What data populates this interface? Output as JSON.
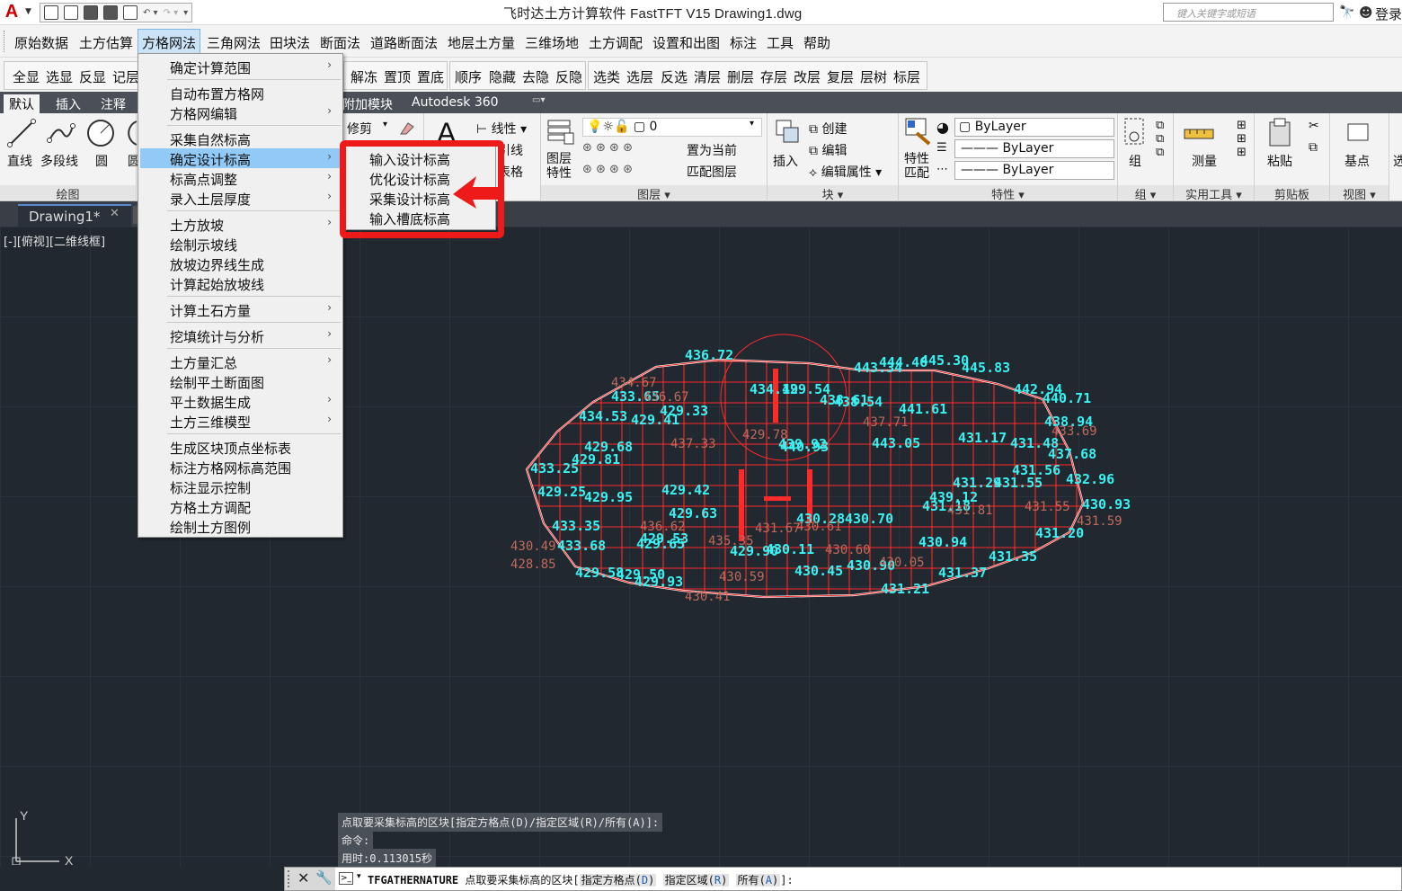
{
  "titlebar": {
    "title": "飞时达土方计算软件 FastTFT V15    Drawing1.dwg",
    "search_placeholder": "键入关键字或短语",
    "login_label": "登录"
  },
  "menubar": {
    "items": [
      "原始数据",
      "土方估算",
      "方格网法",
      "三角网法",
      "田块法",
      "断面法",
      "道路断面法",
      "地层土方量",
      "三维场地",
      "土方调配",
      "设置和出图",
      "标注",
      "工具",
      "帮助"
    ],
    "active_index": 2
  },
  "toolstrip": {
    "left_items": [
      "全显",
      "选显",
      "反显",
      "记层"
    ],
    "right_items": [
      "解冻",
      "置顶",
      "置底",
      "顺序",
      "隐藏",
      "去隐",
      "反隐",
      "选类",
      "选层",
      "反选",
      "清层",
      "删层",
      "存层",
      "改层",
      "复层",
      "层树",
      "标层"
    ]
  },
  "ribbon_tabs": {
    "items": [
      "默认",
      "插入",
      "注释",
      "附加模块",
      "Autodesk 360"
    ],
    "active_index": 0
  },
  "ribbon": {
    "draw": {
      "title": "绘图",
      "line": "直线",
      "polyline": "多段线",
      "circle": "圆",
      "arc": "圆"
    },
    "modify": {
      "trim": "修剪"
    },
    "annotation": {
      "linetype": "线性",
      "leader": "引线",
      "table": "表格"
    },
    "layers": {
      "title": "图层",
      "layer_props": "图层特性",
      "layer_value": "0",
      "set_current": "置为当前",
      "match_layer": "匹配图层"
    },
    "block": {
      "title": "块",
      "insert": "插入",
      "create": "创建",
      "edit": "编辑",
      "edit_attr": "编辑属性"
    },
    "properties": {
      "title": "特性",
      "match": "特性匹配",
      "color": "ByLayer",
      "linetype": "ByLayer",
      "lineweight": "ByLayer"
    },
    "groups": {
      "title": "组",
      "group": "组"
    },
    "utilities": {
      "title": "实用工具",
      "measure": "测量"
    },
    "clipboard": {
      "title": "剪贴板",
      "paste": "粘贴"
    },
    "view": {
      "title": "视图",
      "base": "基点",
      "select": "选"
    }
  },
  "doc_tab": {
    "label": "Drawing1*"
  },
  "viewport": {
    "label": "[-][俯视][二维线框]"
  },
  "dropdown": {
    "items": [
      {
        "label": "确定计算范围",
        "sub": true
      },
      {
        "label": "自动布置方格网",
        "sub": false
      },
      {
        "label": "方格网编辑",
        "sub": true
      },
      {
        "label": "采集自然标高",
        "sub": false
      },
      {
        "label": "确定设计标高",
        "sub": true
      },
      {
        "label": "标高点调整",
        "sub": true
      },
      {
        "label": "录入土层厚度",
        "sub": true
      },
      {
        "label": "土方放坡",
        "sub": true
      },
      {
        "label": "绘制示坡线",
        "sub": false
      },
      {
        "label": "放坡边界线生成",
        "sub": false
      },
      {
        "label": "计算起始放坡线",
        "sub": false
      },
      {
        "label": "计算土石方量",
        "sub": true
      },
      {
        "label": "挖填统计与分析",
        "sub": true
      },
      {
        "label": "土方量汇总",
        "sub": true
      },
      {
        "label": "绘制平土断面图",
        "sub": false
      },
      {
        "label": "平土数据生成",
        "sub": true
      },
      {
        "label": "土方三维模型",
        "sub": true
      },
      {
        "label": "生成区块顶点坐标表",
        "sub": false
      },
      {
        "label": "标注方格网标高范围",
        "sub": false
      },
      {
        "label": "标注显示控制",
        "sub": false
      },
      {
        "label": "方格土方调配",
        "sub": false
      },
      {
        "label": "绘制土方图例",
        "sub": false
      }
    ],
    "highlighted_index": 4
  },
  "submenu": {
    "items": [
      "输入设计标高",
      "优化设计标高",
      "采集设计标高",
      "输入槽底标高"
    ]
  },
  "drawing_labels": {
    "cyan": [
      "436.72",
      "443.34",
      "444.46",
      "445.30",
      "445.83",
      "442.94",
      "440.71",
      "438.94",
      "437.68",
      "432.96",
      "430.93",
      "431.20",
      "431.37",
      "431.35",
      "430.94",
      "430.70",
      "430.45",
      "430.90",
      "431.21",
      "430.11",
      "429.54",
      "429.42",
      "429.63",
      "429.95",
      "429.81",
      "429.68",
      "429.41",
      "429.33",
      "429.58",
      "429.50",
      "429.65",
      "429.90",
      "429.93",
      "429.53",
      "429.25",
      "433.25",
      "433.35",
      "433.68",
      "433.65",
      "434.53",
      "434.19",
      "438.61",
      "438.54",
      "441.61",
      "443.05",
      "431.17",
      "431.48",
      "431.56",
      "431.55",
      "440.93",
      "439.92",
      "430.28",
      "431.18",
      "439.12",
      "431.29"
    ],
    "brown": [
      "434.67",
      "436.67",
      "437.33",
      "436.62",
      "435.35",
      "430.49",
      "428.85",
      "437.71",
      "429.78",
      "431.55",
      "431.59",
      "430.60",
      "430.41",
      "430.05",
      "431.81",
      "430.61",
      "431.67",
      "430.59",
      "433.69"
    ]
  },
  "ucs": {
    "y": "Y",
    "x": "X"
  },
  "command_history": [
    "点取要采集标高的区块[指定方格点(D)/指定区域(R)/所有(A)]:",
    "命令:",
    "用时:0.113015秒"
  ],
  "command_line": {
    "command": "TFGATHERNATURE",
    "prompt": "点取要采集标高的区块",
    "options": [
      {
        "label": "指定方格点",
        "key": "D"
      },
      {
        "label": "指定区域",
        "key": "R"
      },
      {
        "label": "所有",
        "key": "A"
      }
    ],
    "suffix": "]:"
  },
  "colors": {
    "canvas": "#212830",
    "grid_red": "#ff2a2a",
    "label_cyan": "#38f2f2",
    "label_brown": "#c06a5c",
    "highlight_red": "#ee1a1a"
  }
}
